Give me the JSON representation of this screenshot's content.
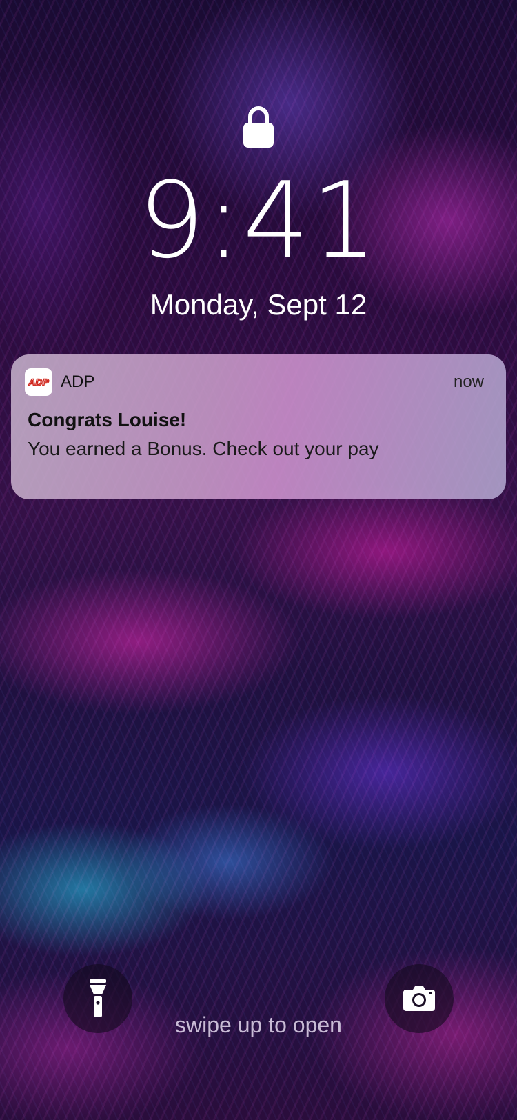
{
  "lockscreen": {
    "time": "9:41",
    "date": "Monday, Sept 12",
    "swipe_hint": "swipe up to open"
  },
  "notification": {
    "app_name": "ADP",
    "app_logo_text": "ADP",
    "time": "now",
    "title": "Congrats Louise!",
    "body": "You earned a Bonus. Check out your pay"
  },
  "icons": {
    "lock": "lock-icon",
    "flashlight": "flashlight-icon",
    "camera": "camera-icon"
  },
  "colors": {
    "adp_brand_red": "#d0271d",
    "text_white": "#ffffff"
  }
}
